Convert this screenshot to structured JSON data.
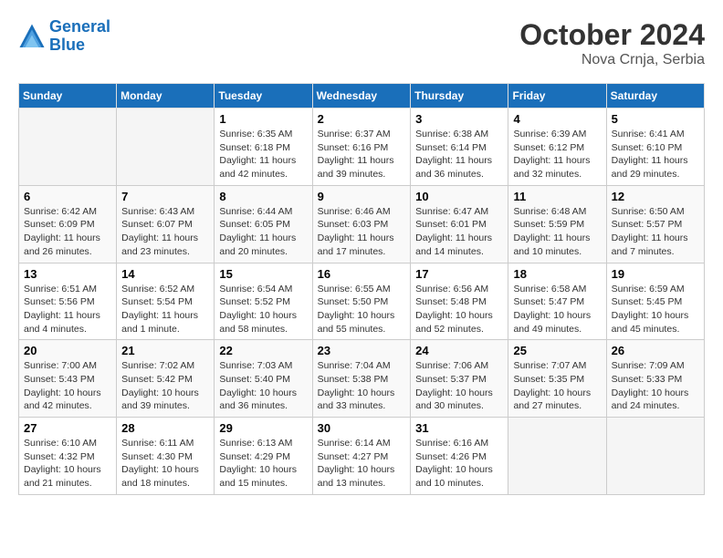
{
  "header": {
    "logo_line1": "General",
    "logo_line2": "Blue",
    "title": "October 2024",
    "subtitle": "Nova Crnja, Serbia"
  },
  "days_of_week": [
    "Sunday",
    "Monday",
    "Tuesday",
    "Wednesday",
    "Thursday",
    "Friday",
    "Saturday"
  ],
  "weeks": [
    [
      {
        "day": "",
        "sunrise": "",
        "sunset": "",
        "daylight": "",
        "empty": true
      },
      {
        "day": "",
        "sunrise": "",
        "sunset": "",
        "daylight": "",
        "empty": true
      },
      {
        "day": "1",
        "sunrise": "Sunrise: 6:35 AM",
        "sunset": "Sunset: 6:18 PM",
        "daylight": "Daylight: 11 hours and 42 minutes."
      },
      {
        "day": "2",
        "sunrise": "Sunrise: 6:37 AM",
        "sunset": "Sunset: 6:16 PM",
        "daylight": "Daylight: 11 hours and 39 minutes."
      },
      {
        "day": "3",
        "sunrise": "Sunrise: 6:38 AM",
        "sunset": "Sunset: 6:14 PM",
        "daylight": "Daylight: 11 hours and 36 minutes."
      },
      {
        "day": "4",
        "sunrise": "Sunrise: 6:39 AM",
        "sunset": "Sunset: 6:12 PM",
        "daylight": "Daylight: 11 hours and 32 minutes."
      },
      {
        "day": "5",
        "sunrise": "Sunrise: 6:41 AM",
        "sunset": "Sunset: 6:10 PM",
        "daylight": "Daylight: 11 hours and 29 minutes."
      }
    ],
    [
      {
        "day": "6",
        "sunrise": "Sunrise: 6:42 AM",
        "sunset": "Sunset: 6:09 PM",
        "daylight": "Daylight: 11 hours and 26 minutes."
      },
      {
        "day": "7",
        "sunrise": "Sunrise: 6:43 AM",
        "sunset": "Sunset: 6:07 PM",
        "daylight": "Daylight: 11 hours and 23 minutes."
      },
      {
        "day": "8",
        "sunrise": "Sunrise: 6:44 AM",
        "sunset": "Sunset: 6:05 PM",
        "daylight": "Daylight: 11 hours and 20 minutes."
      },
      {
        "day": "9",
        "sunrise": "Sunrise: 6:46 AM",
        "sunset": "Sunset: 6:03 PM",
        "daylight": "Daylight: 11 hours and 17 minutes."
      },
      {
        "day": "10",
        "sunrise": "Sunrise: 6:47 AM",
        "sunset": "Sunset: 6:01 PM",
        "daylight": "Daylight: 11 hours and 14 minutes."
      },
      {
        "day": "11",
        "sunrise": "Sunrise: 6:48 AM",
        "sunset": "Sunset: 5:59 PM",
        "daylight": "Daylight: 11 hours and 10 minutes."
      },
      {
        "day": "12",
        "sunrise": "Sunrise: 6:50 AM",
        "sunset": "Sunset: 5:57 PM",
        "daylight": "Daylight: 11 hours and 7 minutes."
      }
    ],
    [
      {
        "day": "13",
        "sunrise": "Sunrise: 6:51 AM",
        "sunset": "Sunset: 5:56 PM",
        "daylight": "Daylight: 11 hours and 4 minutes."
      },
      {
        "day": "14",
        "sunrise": "Sunrise: 6:52 AM",
        "sunset": "Sunset: 5:54 PM",
        "daylight": "Daylight: 11 hours and 1 minute."
      },
      {
        "day": "15",
        "sunrise": "Sunrise: 6:54 AM",
        "sunset": "Sunset: 5:52 PM",
        "daylight": "Daylight: 10 hours and 58 minutes."
      },
      {
        "day": "16",
        "sunrise": "Sunrise: 6:55 AM",
        "sunset": "Sunset: 5:50 PM",
        "daylight": "Daylight: 10 hours and 55 minutes."
      },
      {
        "day": "17",
        "sunrise": "Sunrise: 6:56 AM",
        "sunset": "Sunset: 5:48 PM",
        "daylight": "Daylight: 10 hours and 52 minutes."
      },
      {
        "day": "18",
        "sunrise": "Sunrise: 6:58 AM",
        "sunset": "Sunset: 5:47 PM",
        "daylight": "Daylight: 10 hours and 49 minutes."
      },
      {
        "day": "19",
        "sunrise": "Sunrise: 6:59 AM",
        "sunset": "Sunset: 5:45 PM",
        "daylight": "Daylight: 10 hours and 45 minutes."
      }
    ],
    [
      {
        "day": "20",
        "sunrise": "Sunrise: 7:00 AM",
        "sunset": "Sunset: 5:43 PM",
        "daylight": "Daylight: 10 hours and 42 minutes."
      },
      {
        "day": "21",
        "sunrise": "Sunrise: 7:02 AM",
        "sunset": "Sunset: 5:42 PM",
        "daylight": "Daylight: 10 hours and 39 minutes."
      },
      {
        "day": "22",
        "sunrise": "Sunrise: 7:03 AM",
        "sunset": "Sunset: 5:40 PM",
        "daylight": "Daylight: 10 hours and 36 minutes."
      },
      {
        "day": "23",
        "sunrise": "Sunrise: 7:04 AM",
        "sunset": "Sunset: 5:38 PM",
        "daylight": "Daylight: 10 hours and 33 minutes."
      },
      {
        "day": "24",
        "sunrise": "Sunrise: 7:06 AM",
        "sunset": "Sunset: 5:37 PM",
        "daylight": "Daylight: 10 hours and 30 minutes."
      },
      {
        "day": "25",
        "sunrise": "Sunrise: 7:07 AM",
        "sunset": "Sunset: 5:35 PM",
        "daylight": "Daylight: 10 hours and 27 minutes."
      },
      {
        "day": "26",
        "sunrise": "Sunrise: 7:09 AM",
        "sunset": "Sunset: 5:33 PM",
        "daylight": "Daylight: 10 hours and 24 minutes."
      }
    ],
    [
      {
        "day": "27",
        "sunrise": "Sunrise: 6:10 AM",
        "sunset": "Sunset: 4:32 PM",
        "daylight": "Daylight: 10 hours and 21 minutes."
      },
      {
        "day": "28",
        "sunrise": "Sunrise: 6:11 AM",
        "sunset": "Sunset: 4:30 PM",
        "daylight": "Daylight: 10 hours and 18 minutes."
      },
      {
        "day": "29",
        "sunrise": "Sunrise: 6:13 AM",
        "sunset": "Sunset: 4:29 PM",
        "daylight": "Daylight: 10 hours and 15 minutes."
      },
      {
        "day": "30",
        "sunrise": "Sunrise: 6:14 AM",
        "sunset": "Sunset: 4:27 PM",
        "daylight": "Daylight: 10 hours and 13 minutes."
      },
      {
        "day": "31",
        "sunrise": "Sunrise: 6:16 AM",
        "sunset": "Sunset: 4:26 PM",
        "daylight": "Daylight: 10 hours and 10 minutes."
      },
      {
        "day": "",
        "sunrise": "",
        "sunset": "",
        "daylight": "",
        "empty": true
      },
      {
        "day": "",
        "sunrise": "",
        "sunset": "",
        "daylight": "",
        "empty": true
      }
    ]
  ]
}
